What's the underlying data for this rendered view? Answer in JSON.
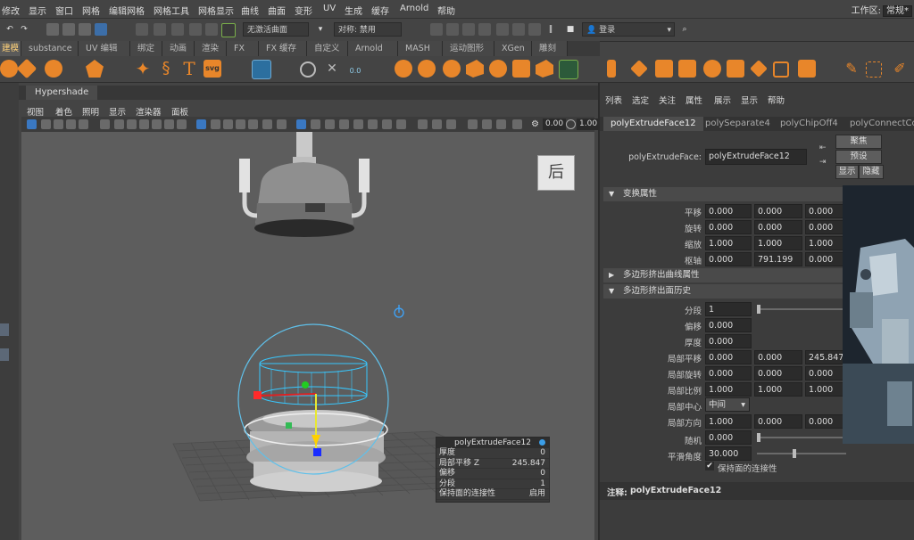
{
  "menubar": {
    "items": [
      "修改",
      "显示",
      "窗口",
      "网格",
      "编辑网格",
      "网格工具",
      "网格显示",
      "曲线",
      "曲面",
      "变形",
      "UV",
      "生成",
      "缓存",
      "Arnold",
      "帮助"
    ],
    "workspace_label": "工作区:",
    "workspace_value": "常规*"
  },
  "statusline": {
    "live_surface": "无激活曲面",
    "symmetry": "对称: 禁用",
    "login": "登录"
  },
  "shelf": {
    "tabs": [
      "建模",
      "substance",
      "UV 编辑",
      "绑定",
      "动画",
      "渲染",
      "FX",
      "FX 缓存",
      "自定义",
      "Arnold",
      "MASH",
      "运动图形",
      "XGen",
      "雕刻"
    ],
    "active_tab": 0,
    "text_icon": "T",
    "svg_icon": "svg",
    "accent": "#e8862a"
  },
  "hypershade": {
    "tab": "Hypershade"
  },
  "viewport": {
    "menu": [
      "视图",
      "着色",
      "照明",
      "显示",
      "渲染器",
      "面板"
    ],
    "field1": "0.00",
    "field2": "1.00",
    "viewcube_label": "后",
    "hud": {
      "title": "polyExtrudeFace12",
      "rows": [
        {
          "label": "厚度",
          "value": "0"
        },
        {
          "label": "局部平移 Z",
          "value": "245.847"
        },
        {
          "label": "偏移",
          "value": "0"
        },
        {
          "label": "分段",
          "value": "1"
        },
        {
          "label": "保持面的连接性",
          "value": "启用"
        }
      ]
    }
  },
  "attr_editor": {
    "menu": [
      "列表",
      "选定",
      "关注",
      "属性",
      "展示",
      "显示",
      "帮助"
    ],
    "tabs": [
      "polyExtrudeFace12",
      "polySeparate4",
      "polyChipOff4",
      "polyConnectCom"
    ],
    "node_label": "polyExtrudeFace:",
    "node_name": "polyExtrudeFace12",
    "buttons": {
      "focus": "聚焦",
      "presets": "预设",
      "show": "显示",
      "hide": "隐藏"
    },
    "sections": {
      "transform": "变换属性",
      "curve": "多边形挤出曲线属性",
      "history": "多边形挤出面历史"
    },
    "transform_rows": [
      {
        "label": "平移",
        "values": [
          "0.000",
          "0.000",
          "0.000"
        ]
      },
      {
        "label": "旋转",
        "values": [
          "0.000",
          "0.000",
          "0.000"
        ]
      },
      {
        "label": "缩放",
        "values": [
          "1.000",
          "1.000",
          "1.000"
        ]
      },
      {
        "label": "枢轴",
        "values": [
          "0.000",
          "791.199",
          "0.000"
        ]
      }
    ],
    "history": {
      "divisions_label": "分段",
      "divisions": "1",
      "offset_label": "偏移",
      "offset": "0.000",
      "thickness_label": "厚度",
      "thickness": "0.000",
      "local_translate_label": "局部平移",
      "local_translate": [
        "0.000",
        "0.000",
        "245.847"
      ],
      "local_rotate_label": "局部旋转",
      "local_rotate": [
        "0.000",
        "0.000",
        "0.000"
      ],
      "local_scale_label": "局部比例",
      "local_scale": [
        "1.000",
        "1.000",
        "1.000"
      ],
      "local_center_label": "局部中心",
      "local_center": "中间",
      "local_direction_label": "局部方向",
      "local_direction": [
        "1.000",
        "0.000",
        "0.000"
      ],
      "random_label": "随机",
      "random": "0.000",
      "smoothing_label": "平滑角度",
      "smoothing": "30.000",
      "keep_faces_label": "保持面的连接性",
      "keep_faces": "✔"
    },
    "notes_label": "注释:",
    "notes_value": "polyExtrudeFace12"
  }
}
